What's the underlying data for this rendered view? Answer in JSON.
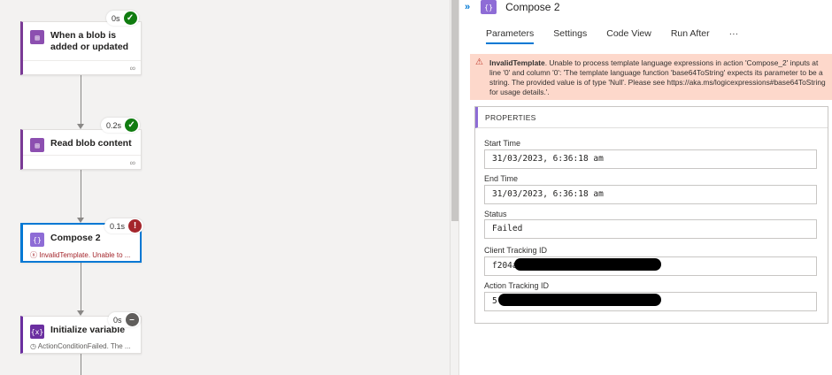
{
  "canvas": {
    "cards": [
      {
        "title": "When a blob is added or updated",
        "badge_time": "0s",
        "status": "succeeded"
      },
      {
        "title": "Read blob content",
        "badge_time": "0.2s",
        "status": "succeeded"
      },
      {
        "title": "Compose 2",
        "badge_time": "0.1s",
        "status": "failed",
        "message": "InvalidTemplate. Unable to ..."
      },
      {
        "title": "Initialize variable",
        "badge_time": "0s",
        "status": "skipped",
        "message": "ActionConditionFailed. The ..."
      }
    ]
  },
  "panel": {
    "title": "Compose 2",
    "tabs": [
      "Parameters",
      "Settings",
      "Code View",
      "Run After",
      "···"
    ],
    "active_tab": "Parameters",
    "error": {
      "code": "InvalidTemplate",
      "message": ". Unable to process template language expressions in action 'Compose_2' inputs at line '0' and column '0': 'The template language function 'base64ToString' expects its parameter to be a string. The provided value is of type 'Null'. Please see https://aka.ms/logicexpressions#base64ToString for usage details.'."
    },
    "properties": {
      "header": "PROPERTIES",
      "start_time_label": "Start Time",
      "start_time": "31/03/2023, 6:36:18 am",
      "end_time_label": "End Time",
      "end_time": "31/03/2023, 6:36:18 am",
      "status_label": "Status",
      "status": "Failed",
      "client_tracking_label": "Client Tracking ID",
      "client_tracking_value": "f204a",
      "action_tracking_label": "Action Tracking ID",
      "action_tracking_value": "5"
    }
  }
}
